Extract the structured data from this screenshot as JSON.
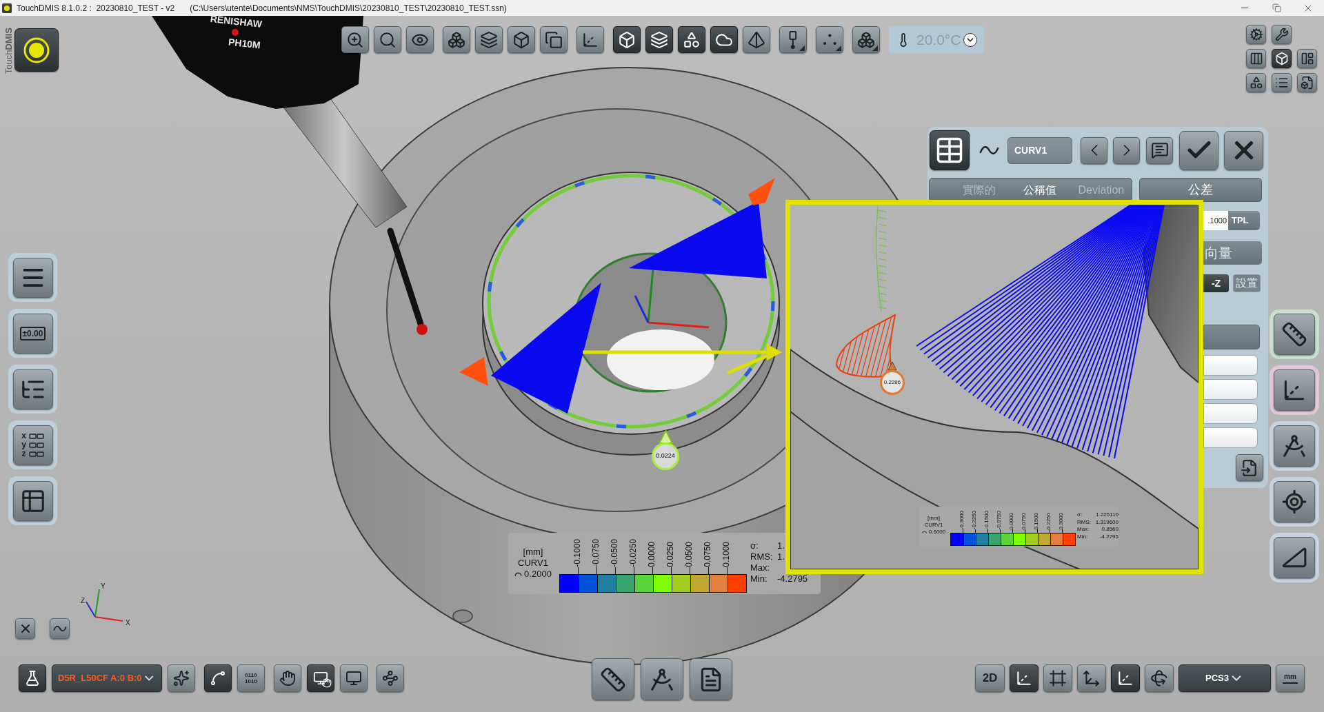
{
  "window": {
    "title": "TouchDMIS 8.1.0.2 :  20230810_TEST - v2",
    "path": "(C:\\Users\\utente\\Documents\\NMS\\TouchDMIS\\20230810_TEST\\20230810_TEST.ssn)"
  },
  "brand": {
    "text": "Touch**DMIS**"
  },
  "top_toolbar": {
    "groups": [
      [
        {
          "kind": "zoom-window",
          "on": false
        },
        {
          "kind": "zoom-target",
          "on": false
        },
        {
          "kind": "view-eye",
          "on": false
        }
      ],
      [
        {
          "kind": "view-iso",
          "on": false
        },
        {
          "kind": "view-top",
          "on": false
        },
        {
          "kind": "view-side",
          "on": false
        },
        {
          "kind": "view-split",
          "on": false
        }
      ],
      [
        {
          "kind": "axis-probe",
          "on": false
        }
      ],
      [
        {
          "kind": "solid",
          "on": true
        },
        {
          "kind": "planes",
          "on": true
        },
        {
          "kind": "shape",
          "on": true
        },
        {
          "kind": "cloud",
          "on": true
        },
        {
          "kind": "pyramid",
          "on": false
        }
      ],
      [
        {
          "kind": "probe",
          "on": false,
          "menu": true
        }
      ],
      [
        {
          "kind": "points",
          "on": false,
          "menu": true
        }
      ],
      [
        {
          "kind": "cubes",
          "on": false,
          "menu": true
        }
      ]
    ]
  },
  "temperature": {
    "value": "20.0°C",
    "disabled": true
  },
  "view_grid": {
    "rows": [
      [
        {
          "kind": "gear",
          "on": false
        },
        {
          "kind": "wrench",
          "on": false
        }
      ],
      [
        {
          "kind": "probes",
          "on": false
        },
        {
          "kind": "solid",
          "on": true
        },
        {
          "kind": "layout",
          "on": false
        }
      ],
      [
        {
          "kind": "shapes",
          "on": false
        },
        {
          "kind": "list",
          "on": false
        },
        {
          "kind": "file-box",
          "on": false
        }
      ]
    ]
  },
  "left_sidebar": {
    "items": [
      {
        "kind": "lines"
      },
      {
        "kind": "value",
        "text": "±0.00"
      },
      {
        "kind": "tree"
      },
      {
        "kind": "xyz",
        "letters": [
          "x",
          "y",
          "z"
        ]
      },
      {
        "kind": "table"
      }
    ]
  },
  "axis_triad": {
    "x": "X",
    "y": "Y",
    "z": "Z"
  },
  "view_controls": [
    {
      "kind": "close"
    },
    {
      "kind": "curve"
    }
  ],
  "viewport": {
    "probe_labels": [
      "RENISHAW",
      "PH10M"
    ],
    "marker": "0.0224"
  },
  "legend": {
    "unit": "[mm]",
    "name": "CURV1",
    "range": "0.2000",
    "ticks": [
      "-0.1000",
      "-0.0750",
      "-0.0500",
      "-0.0250",
      "0.0000",
      "0.0250",
      "0.0500",
      "0.0750",
      "0.1000"
    ],
    "colors": [
      {
        "color": "#0000ff"
      },
      {
        "color": "#0050d8"
      },
      {
        "color": "#1f7f9f"
      },
      {
        "color": "#38a56e"
      },
      {
        "color": "#5ad23a"
      },
      {
        "color": "#80ff00"
      },
      {
        "color": "#a3cc20"
      },
      {
        "color": "#c0a830"
      },
      {
        "color": "#e07f40"
      },
      {
        "color": "#ff4000"
      }
    ],
    "stats": [
      {
        "label": "σ:",
        "value": "1."
      },
      {
        "label": "RMS:",
        "value": "1."
      },
      {
        "label": "Max:"
      },
      {
        "label": "Min:",
        "value": "-4.2795"
      }
    ]
  },
  "feature_panel": {
    "feature_name": "CURV1",
    "view_tabs": [
      {
        "label": "實際的",
        "selected": false
      },
      {
        "label": "公稱值",
        "selected": true
      },
      {
        "label": "Deviation",
        "selected": false
      }
    ],
    "tolerance_tab": {
      "label": "公差",
      "selected": true
    },
    "tolerance_value": ".1000",
    "tolerance_type": "TPL",
    "vector_label": "向量",
    "direction": "-Z",
    "set_button": {
      "label": "設置",
      "disabled": true
    }
  },
  "side_tools": [
    {
      "kind": "caliper",
      "color": "#c8e1cd"
    },
    {
      "kind": "axes",
      "color": "#e1c8d8"
    },
    {
      "kind": "geometry",
      "color": "#c8d2e1"
    },
    {
      "kind": "probe-axes",
      "color": "#c8d2e1"
    },
    {
      "kind": "measure",
      "color": "#c8d2e1"
    }
  ],
  "inset": {
    "marker": "0.2286",
    "legend": {
      "unit": "[mm]",
      "name": "CURV1",
      "range": "0.6000",
      "ticks": [
        "-0.3000",
        "-0.2250",
        "-0.1500",
        "-0.0750",
        "0.0000",
        "0.0750",
        "0.1500",
        "0.2250",
        "0.3000"
      ],
      "colors": [
        {
          "color": "#0000ff"
        },
        {
          "color": "#0050d8"
        },
        {
          "color": "#1f7f9f"
        },
        {
          "color": "#38a56e"
        },
        {
          "color": "#5ad23a"
        },
        {
          "color": "#80ff00"
        },
        {
          "color": "#a3cc20"
        },
        {
          "color": "#c0a830"
        },
        {
          "color": "#e07f40"
        },
        {
          "color": "#ff4000"
        }
      ],
      "stats": [
        {
          "label": "σ:",
          "value": "1.225110"
        },
        {
          "label": "RMS:",
          "value": "1.319600"
        },
        {
          "label": "Max:",
          "value": "0.8560"
        },
        {
          "label": "Min:",
          "value": "-4.2795"
        }
      ]
    }
  },
  "bottom_toolbar": {
    "left": [
      [
        {
          "kind": "flask",
          "on": true
        },
        {
          "kind": "dropdown",
          "value": "D5R_L50CF A:0 B:0",
          "color": "#ff5a1e"
        },
        {
          "kind": "sparkle",
          "on": false
        }
      ],
      [
        {
          "kind": "path",
          "on": true
        },
        {
          "kind": "binary",
          "on": false,
          "lines": [
            "0110",
            "1010"
          ]
        }
      ],
      [
        {
          "kind": "hand",
          "on": false
        },
        {
          "kind": "monitor-hand",
          "on": true
        },
        {
          "kind": "monitor",
          "on": false
        }
      ],
      [
        {
          "kind": "probe-path",
          "on": false
        }
      ]
    ],
    "center": [
      {
        "kind": "caliper",
        "on": false
      },
      {
        "kind": "geometry",
        "on": false
      },
      {
        "kind": "report",
        "on": false
      }
    ],
    "right": [
      {
        "kind": "text",
        "label": "2D",
        "on": false
      },
      {
        "kind": "axes",
        "on": true
      },
      {
        "kind": "axes-frame",
        "on": false
      },
      {
        "kind": "axes-tilt",
        "on": false
      },
      {
        "kind": "axes",
        "on": true
      },
      {
        "kind": "axes-rotate",
        "on": false
      },
      {
        "kind": "dropdown",
        "value": "PCS3",
        "color": "#ffffff"
      },
      {
        "kind": "unit",
        "label": "mm",
        "on": false
      }
    ]
  }
}
